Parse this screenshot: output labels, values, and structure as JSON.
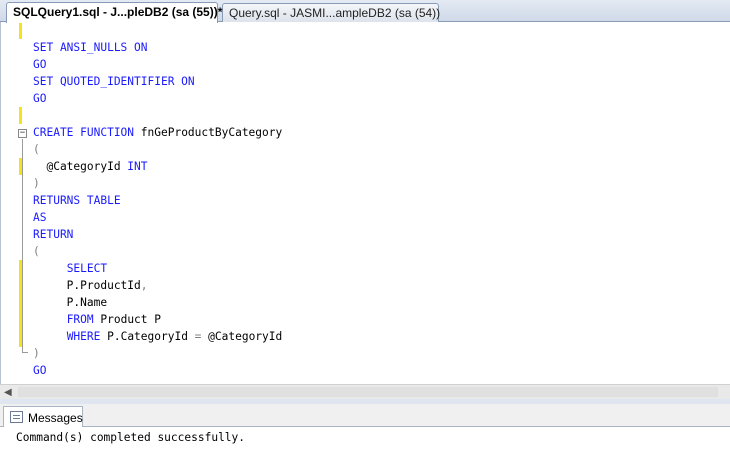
{
  "tabs": [
    {
      "label": "SQLQuery1.sql - J...pleDB2 (sa (55))*",
      "active": true
    },
    {
      "label": "Query.sql - JASMI...ampleDB2 (sa (54))",
      "active": false
    }
  ],
  "code_lines": [
    [
      [
        "kw",
        "SET ANSI_NULLS ON"
      ]
    ],
    [
      [
        "kw",
        "GO"
      ]
    ],
    [
      [
        "kw",
        "SET QUOTED_IDENTIFIER ON"
      ]
    ],
    [
      [
        "kw",
        "GO"
      ]
    ],
    [],
    [
      [
        "kw",
        "CREATE FUNCTION"
      ],
      [
        "txt",
        " fnGeProductByCategory"
      ]
    ],
    [
      [
        "gray",
        "("
      ]
    ],
    [
      [
        "txt",
        "  @CategoryId "
      ],
      [
        "kw",
        "INT"
      ]
    ],
    [
      [
        "gray",
        ")"
      ]
    ],
    [
      [
        "kw",
        "RETURNS TABLE"
      ]
    ],
    [
      [
        "kw",
        "AS"
      ]
    ],
    [
      [
        "kw",
        "RETURN"
      ]
    ],
    [
      [
        "gray",
        "("
      ]
    ],
    [
      [
        "txt",
        "     "
      ],
      [
        "kw",
        "SELECT"
      ]
    ],
    [
      [
        "txt",
        "     P.ProductId"
      ],
      [
        "gray",
        ","
      ]
    ],
    [
      [
        "txt",
        "     P.Name"
      ]
    ],
    [
      [
        "txt",
        "     "
      ],
      [
        "kw",
        "FROM"
      ],
      [
        "txt",
        " Product P"
      ]
    ],
    [
      [
        "txt",
        "     "
      ],
      [
        "kw",
        "WHERE"
      ],
      [
        "txt",
        " P.CategoryId "
      ],
      [
        "gray",
        "="
      ],
      [
        "txt",
        " @CategoryId"
      ]
    ],
    [
      [
        "gray",
        ")"
      ]
    ],
    [
      [
        "kw",
        "GO"
      ]
    ]
  ],
  "results": {
    "tab_label": "Messages",
    "message": "Command(s) completed successfully."
  },
  "icons": {
    "collapse": "collapse-minus-icon",
    "messages": "messages-icon",
    "scroll_left": "scroll-left-arrow-icon"
  }
}
